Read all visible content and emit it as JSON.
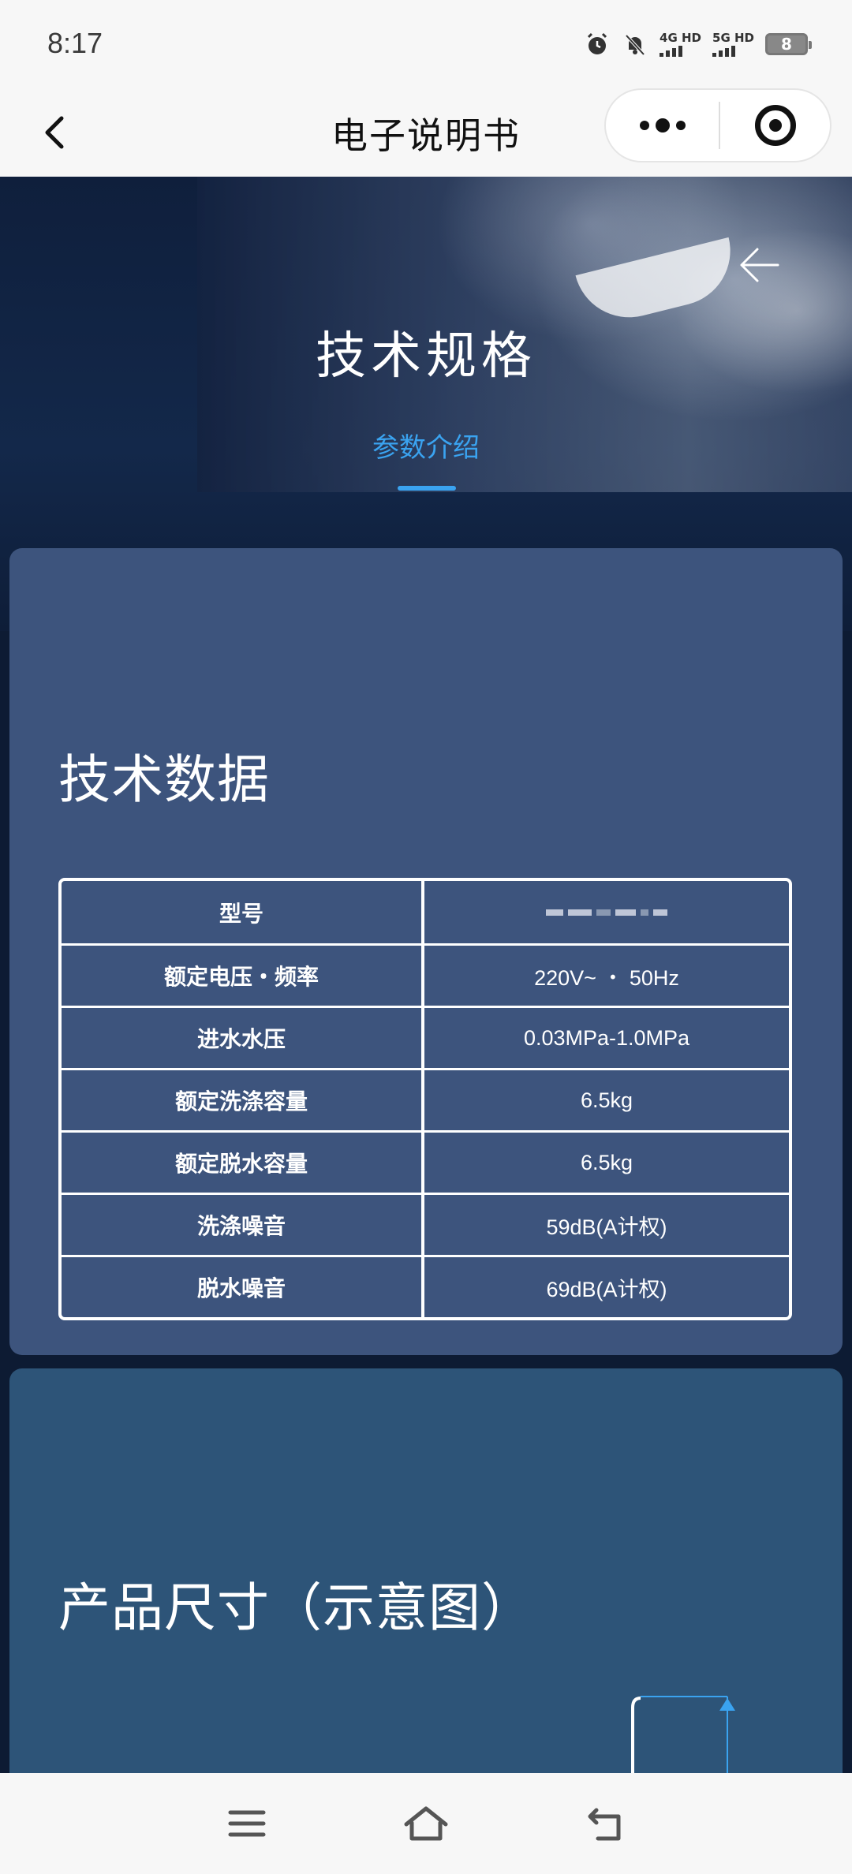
{
  "status_bar": {
    "time": "8:17",
    "net1": "4G HD",
    "net2": "5G HD",
    "battery": "8"
  },
  "title_bar": {
    "title": "电子说明书",
    "icons": [
      "back-icon",
      "more-icon",
      "close-target-icon"
    ]
  },
  "hero": {
    "title": "技术规格",
    "tab_label": "参数介绍",
    "accent_color": "#3aa3f0"
  },
  "spec_card": {
    "title": "技术数据",
    "rows": [
      {
        "label": "型号",
        "value": ""
      },
      {
        "label": "额定电压・频率",
        "value": "220V~ ・ 50Hz"
      },
      {
        "label": "进水水压",
        "value": "0.03MPa-1.0MPa"
      },
      {
        "label": "额定洗涤容量",
        "value": "6.5kg"
      },
      {
        "label": "额定脱水容量",
        "value": "6.5kg"
      },
      {
        "label": "洗涤噪音",
        "value": "59dB(A计权)"
      },
      {
        "label": "脱水噪音",
        "value": "69dB(A计权)"
      }
    ]
  },
  "dim_card": {
    "title": "产品尺寸（示意图）"
  },
  "nav_bar": {
    "icons": [
      "menu-icon",
      "home-icon",
      "return-icon"
    ]
  },
  "colors": {
    "spec_card_bg": "#3d547d",
    "dim_card_bg": "#2d5478",
    "page_bg": "#0d1b33"
  }
}
